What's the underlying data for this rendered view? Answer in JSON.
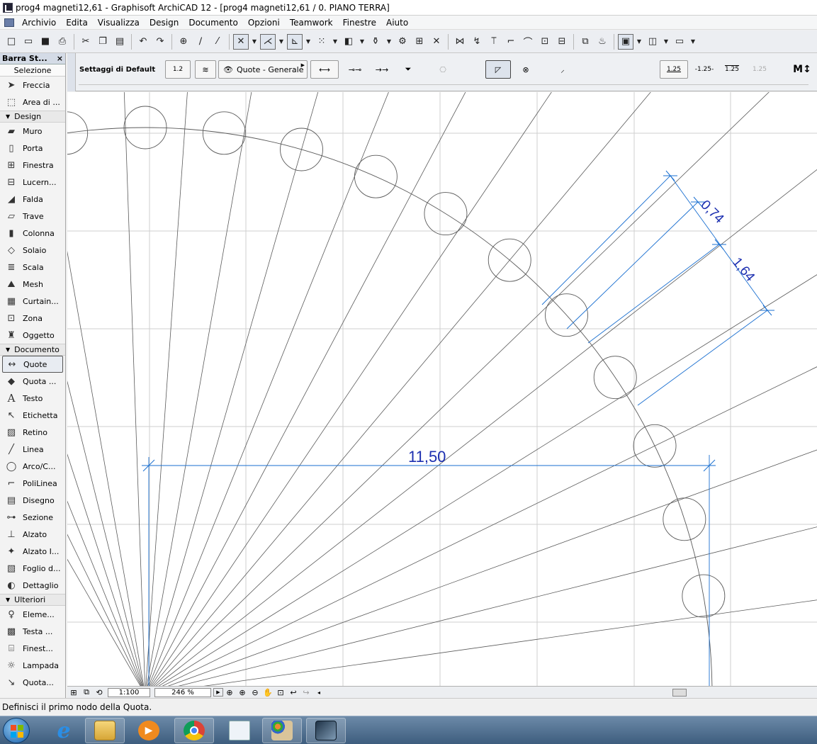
{
  "window": {
    "title": "prog4 magneti12,61 - Graphisoft ArchiCAD 12 - [prog4 magneti12,61 / 0. PIANO TERRA]"
  },
  "menu": [
    "Archivio",
    "Edita",
    "Visualizza",
    "Design",
    "Documento",
    "Opzioni",
    "Teamwork",
    "Finestre",
    "Aiuto"
  ],
  "toolbox": {
    "title": "Barra St...",
    "close": "×",
    "selection_label": "Selezione",
    "select_tools": [
      {
        "label": "Freccia",
        "icon": "arrow-cursor-icon"
      },
      {
        "label": "Area di ...",
        "icon": "marquee-icon"
      }
    ],
    "groups": [
      {
        "label": "Design",
        "tools": [
          {
            "label": "Muro",
            "icon": "wall-icon"
          },
          {
            "label": "Porta",
            "icon": "door-icon"
          },
          {
            "label": "Finestra",
            "icon": "window-icon"
          },
          {
            "label": "Lucern...",
            "icon": "skylight-icon"
          },
          {
            "label": "Falda",
            "icon": "roof-icon"
          },
          {
            "label": "Trave",
            "icon": "beam-icon"
          },
          {
            "label": "Colonna",
            "icon": "column-icon"
          },
          {
            "label": "Solaio",
            "icon": "slab-icon"
          },
          {
            "label": "Scala",
            "icon": "stair-icon"
          },
          {
            "label": "Mesh",
            "icon": "mesh-icon"
          },
          {
            "label": "Curtain...",
            "icon": "curtain-wall-icon"
          },
          {
            "label": "Zona",
            "icon": "zone-icon"
          },
          {
            "label": "Oggetto",
            "icon": "object-icon"
          }
        ]
      },
      {
        "label": "Documento",
        "tools": [
          {
            "label": "Quote",
            "icon": "dimension-icon",
            "active": true
          },
          {
            "label": "Quota ...",
            "icon": "level-dimension-icon"
          },
          {
            "label": "Testo",
            "icon": "text-icon"
          },
          {
            "label": "Etichetta",
            "icon": "label-icon"
          },
          {
            "label": "Retino",
            "icon": "fill-icon"
          },
          {
            "label": "Linea",
            "icon": "line-icon"
          },
          {
            "label": "Arco/C...",
            "icon": "arc-icon"
          },
          {
            "label": "PoliLinea",
            "icon": "polyline-icon"
          },
          {
            "label": "Disegno",
            "icon": "drawing-icon"
          },
          {
            "label": "Sezione",
            "icon": "section-icon"
          },
          {
            "label": "Alzato",
            "icon": "elevation-icon"
          },
          {
            "label": "Alzato I...",
            "icon": "interior-elevation-icon"
          },
          {
            "label": "Foglio d...",
            "icon": "worksheet-icon"
          },
          {
            "label": "Dettaglio",
            "icon": "detail-icon"
          }
        ]
      },
      {
        "label": "Ulteriori",
        "tools": [
          {
            "label": "Eleme...",
            "icon": "element-icon"
          },
          {
            "label": "Testa ...",
            "icon": "head-icon"
          },
          {
            "label": "Finest...",
            "icon": "window-frame-icon"
          },
          {
            "label": "Lampada",
            "icon": "lamp-icon"
          },
          {
            "label": "Quota...",
            "icon": "dimension-more-icon"
          }
        ]
      }
    ]
  },
  "infobox": {
    "settings_label": "Settaggi di Default",
    "dim_icon_text": "1.2",
    "layer_label": "Quote - Generale",
    "format_a": "1.25",
    "format_b": "-1.25-",
    "format_c": "1.25",
    "format_d": "1.25"
  },
  "canvas": {
    "dims": {
      "horizontal": "11,50",
      "angled_1": "0,74",
      "angled_2": "1,64"
    },
    "colors": {
      "dimension": "#1a6fd0",
      "dim_text": "#1c2fb0",
      "grid": "#cfcfcf",
      "geometry": "#5a5a5a"
    }
  },
  "canvasbar": {
    "scale": "1:100",
    "zoom": "246 %"
  },
  "status": {
    "message": "Definisci il primo nodo della Quota."
  },
  "taskbar": {
    "apps": [
      {
        "name": "internet-explorer-icon",
        "glyph": "e"
      },
      {
        "name": "file-explorer-icon",
        "glyph": ""
      },
      {
        "name": "media-player-icon",
        "glyph": "▶"
      },
      {
        "name": "chrome-icon",
        "glyph": ""
      },
      {
        "name": "app-icon",
        "glyph": ""
      },
      {
        "name": "paint-icon",
        "glyph": ""
      },
      {
        "name": "archicad-icon",
        "glyph": ""
      }
    ]
  }
}
